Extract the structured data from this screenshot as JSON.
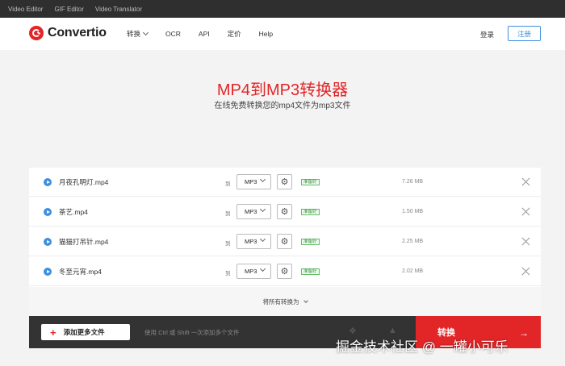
{
  "topbar": {
    "links": [
      "Video Editor",
      "GIF Editor",
      "Video Translator"
    ]
  },
  "brand": {
    "name": "Convertio",
    "accent": "#e22527"
  },
  "nav": {
    "items": [
      "转换",
      "OCR",
      "API",
      "定价",
      "Help"
    ],
    "login": "登录",
    "signup": "注册"
  },
  "hero": {
    "title": "MP4到MP3转换器",
    "subtitle": "在线免费转换您的mp4文件为mp3文件"
  },
  "files": [
    {
      "name": "月夜孔明灯.mp4",
      "to": "到",
      "format": "MP3",
      "status": "准备好",
      "size": "7.26 MB"
    },
    {
      "name": "茶艺.mp4",
      "to": "到",
      "format": "MP3",
      "status": "准备好",
      "size": "1.50 MB"
    },
    {
      "name": "猫猫打吊针.mp4",
      "to": "到",
      "format": "MP3",
      "status": "准备好",
      "size": "2.25 MB"
    },
    {
      "name": "冬至元宵.mp4",
      "to": "到",
      "format": "MP3",
      "status": "准备好",
      "size": "2.02 MB"
    }
  ],
  "convert_all": {
    "label": "将所有转换为"
  },
  "bottom": {
    "add_label": "添加更多文件",
    "hint": "使用 Ctrl 或 Shift 一次添加多个文件",
    "convert_label": "转换"
  },
  "watermark": "掘金技术社区 @ 一罐小可乐"
}
